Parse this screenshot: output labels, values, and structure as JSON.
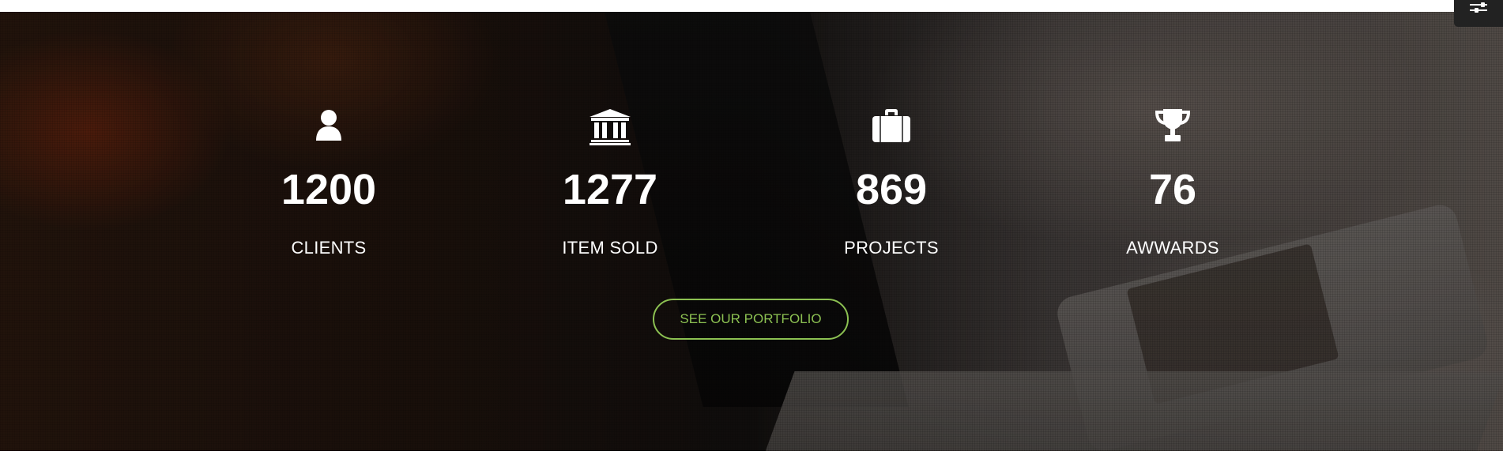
{
  "stats": [
    {
      "icon": "user-icon",
      "value": "1200",
      "label": "CLIENTS"
    },
    {
      "icon": "bank-icon",
      "value": "1277",
      "label": "ITEM SOLD"
    },
    {
      "icon": "briefcase-icon",
      "value": "869",
      "label": "PROJECTS"
    },
    {
      "icon": "trophy-icon",
      "value": "76",
      "label": "AWWARDS"
    }
  ],
  "cta": {
    "label": "SEE OUR PORTFOLIO"
  },
  "colors": {
    "accent": "#8cc152",
    "text": "#ffffff",
    "settings_bg": "#222222"
  },
  "settings": {
    "icon": "sliders-icon"
  }
}
